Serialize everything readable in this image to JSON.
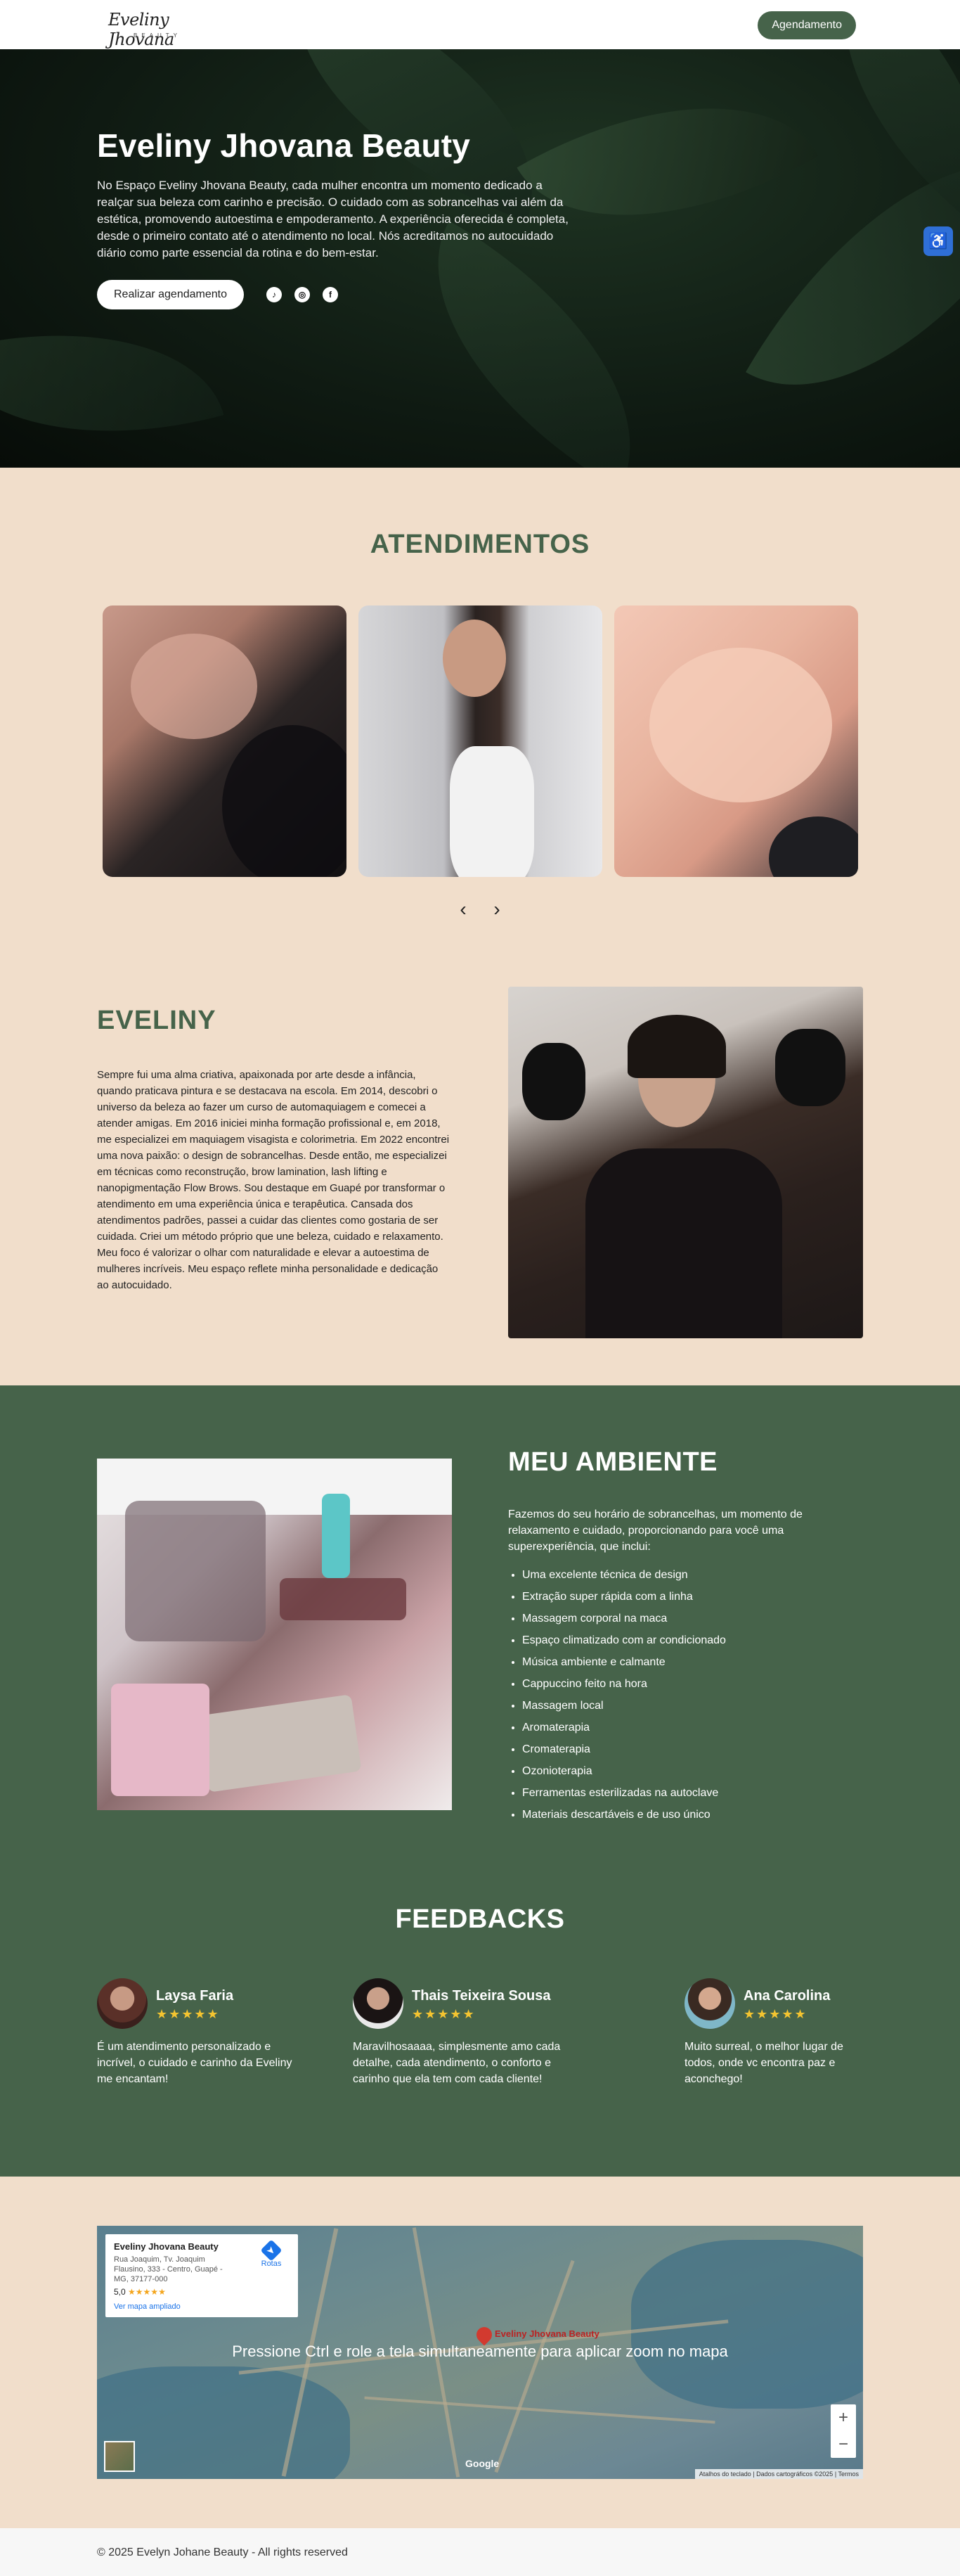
{
  "header": {
    "logo_script": "Eveliny Jhovana",
    "logo_sub": "BEAUTY",
    "cta": "Agendamento"
  },
  "hero": {
    "title": "Eveliny Jhovana Beauty",
    "text": "No Espaço Eveliny Jhovana Beauty, cada mulher encontra um momento dedicado a realçar sua beleza com carinho e precisão. O cuidado com as sobrancelhas vai além da estética, promovendo autoestima e empoderamento. A experiência oferecida é completa, desde o primeiro contato até o atendimento no local. Nós acreditamos no autocuidado diário como parte essencial da rotina e do bem-estar.",
    "cta": "Realizar agendamento",
    "social": [
      {
        "icon": "tiktok-icon",
        "glyph": "♪"
      },
      {
        "icon": "instagram-icon",
        "glyph": "◎"
      },
      {
        "icon": "facebook-icon",
        "glyph": "f"
      }
    ]
  },
  "services": {
    "title": "ATENDIMENTOS",
    "prev_glyph": "‹",
    "next_glyph": "›"
  },
  "about": {
    "title": "EVELINY",
    "text": "Sempre fui uma alma criativa, apaixonada por arte desde a infância, quando praticava pintura e se destacava na escola. Em 2014, descobri o universo da beleza ao fazer um curso de automaquiagem e comecei a atender amigas. Em 2016 iniciei minha formação profissional e, em 2018, me especializei em maquiagem visagista e colorimetria. Em 2022 encontrei uma nova paixão: o design de sobrancelhas. Desde então, me especializei em técnicas como reconstrução, brow lamination, lash lifting e nanopigmentação Flow Brows. Sou destaque em Guapé por transformar o atendimento em uma experiência única e terapêutica. Cansada dos atendimentos padrões, passei a cuidar das clientes como gostaria de ser cuidada. Criei um método próprio que une beleza, cuidado e relaxamento. Meu foco é valorizar o olhar com naturalidade e elevar a autoestima de mulheres incríveis. Meu espaço reflete minha personalidade e dedicação ao autocuidado."
  },
  "ambiente": {
    "title": "MEU AMBIENTE",
    "intro": "Fazemos do seu horário de sobrancelhas, um momento de relaxamento e cuidado, proporcionando para você uma superexperiência, que inclui:",
    "items": [
      "Uma excelente técnica de design",
      "Extração super rápida com a linha",
      "Massagem corporal na maca",
      "Espaço climatizado com ar condicionado",
      "Música ambiente e calmante",
      "Cappuccino feito na hora",
      "Massagem local",
      "Aromaterapia",
      "Cromaterapia",
      "Ozonioterapia",
      "Ferramentas esterilizadas na autoclave",
      "Materiais descartáveis e de uso único"
    ]
  },
  "feedbacks": {
    "title": "FEEDBACKS",
    "items": [
      {
        "name": "Laysa Faria",
        "stars": "★★★★★",
        "rating": 5,
        "text": "É um atendimento personalizado e incrível, o cuidado e carinho da Eveliny me encantam!"
      },
      {
        "name": "Thais Teixeira Sousa",
        "stars": "★★★★★",
        "rating": 5,
        "text": "Maravilhosaaaa, simplesmente amo cada detalhe, cada atendimento, o conforto e carinho que ela tem com cada cliente!"
      },
      {
        "name": "Ana Carolina",
        "stars": "★★★★★",
        "rating": 5,
        "text": "Muito surreal, o melhor lugar de todos, onde vc encontra paz e aconchego!"
      }
    ]
  },
  "map": {
    "place_name": "Eveliny Jhovana Beauty",
    "address": "Rua Joaquim, Tv. Joaquim Flausino, 333 - Centro, Guapé - MG, 37177-000",
    "rating": "5,0",
    "rating_stars": "★★★★★",
    "larger_map": "Ver mapa ampliado",
    "routes": "Rotas",
    "overlay_msg": "Pressione Ctrl e role a tela simultaneamente para aplicar zoom no mapa",
    "pin_label": "Eveliny Jhovana Beauty",
    "zoom_in": "+",
    "zoom_out": "−",
    "google": "Google",
    "attribution": "Atalhos do teclado  |  Dados cartográficos ©2025  |  Termos"
  },
  "footer": {
    "text": "© 2025 Evelyn Johane Beauty - All rights reserved"
  },
  "colors": {
    "brand_green": "#46634a",
    "beige": "#f1decb",
    "star": "#f4c430"
  }
}
